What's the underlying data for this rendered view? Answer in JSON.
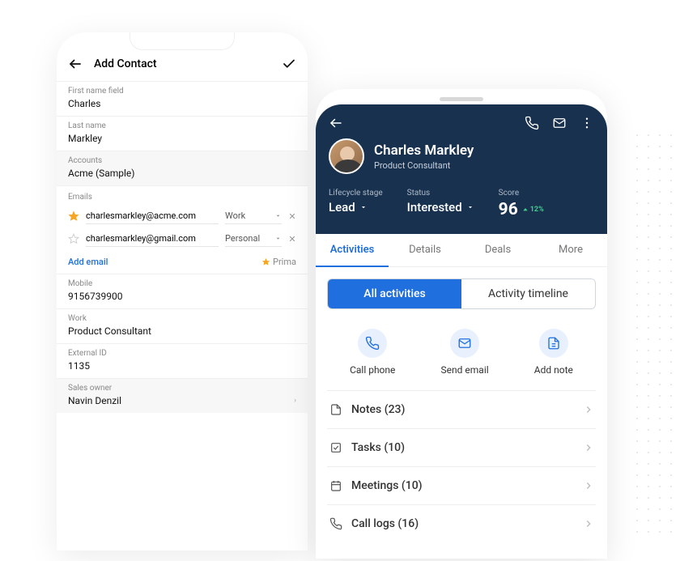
{
  "phone1": {
    "title": "Add Contact",
    "fields": {
      "first_name": {
        "label": "First name field",
        "value": "Charles"
      },
      "last_name": {
        "label": "Last name",
        "value": "Markley"
      },
      "accounts": {
        "label": "Accounts",
        "value": "Acme (Sample)"
      },
      "mobile": {
        "label": "Mobile",
        "value": "9156739900"
      },
      "work": {
        "label": "Work",
        "value": "Product Consultant"
      },
      "external_id": {
        "label": "External ID",
        "value": "1135"
      },
      "sales_owner": {
        "label": "Sales owner",
        "value": "Navin Denzil"
      }
    },
    "emails": {
      "label": "Emails",
      "rows": [
        {
          "address": "charlesmarkley@acme.com",
          "type": "Work",
          "primary": true
        },
        {
          "address": "charlesmarkley@gmail.com",
          "type": "Personal",
          "primary": false
        }
      ],
      "add_label": "Add email",
      "primary_label": "Prima"
    }
  },
  "phone2": {
    "contact": {
      "name": "Charles Markley",
      "role": "Product Consultant"
    },
    "stats": {
      "lifecycle": {
        "label": "Lifecycle stage",
        "value": "Lead"
      },
      "status": {
        "label": "Status",
        "value": "Interested"
      },
      "score": {
        "label": "Score",
        "value": "96",
        "delta": "12%"
      }
    },
    "tabs": [
      "Activities",
      "Details",
      "Deals",
      "More"
    ],
    "segment": {
      "left": "All activities",
      "right": "Activity timeline"
    },
    "actions": {
      "call": "Call phone",
      "email": "Send email",
      "note": "Add note"
    },
    "list": [
      {
        "label": "Notes (23)"
      },
      {
        "label": "Tasks (10)"
      },
      {
        "label": "Meetings (10)"
      },
      {
        "label": "Call logs (16)"
      }
    ]
  }
}
